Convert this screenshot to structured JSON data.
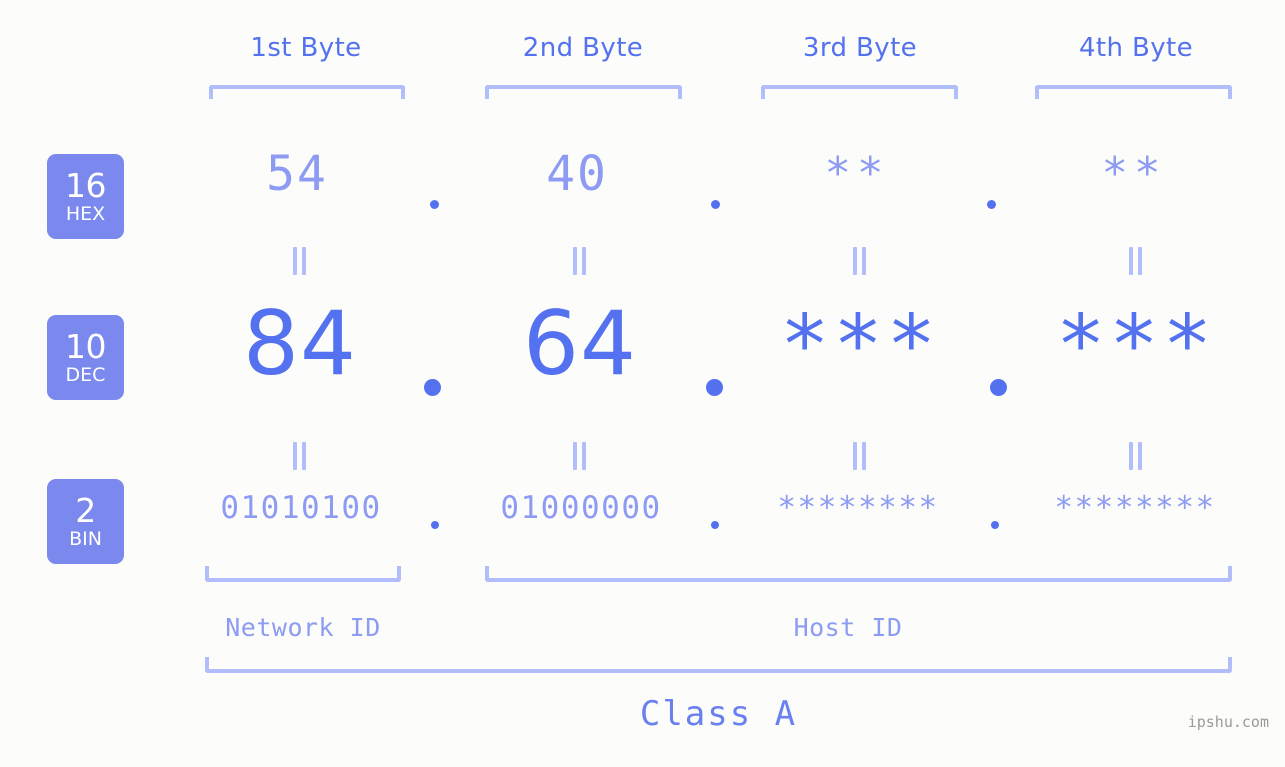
{
  "background_color": "#fcfdfa",
  "accent_colors": {
    "strong": "#5471ef",
    "medium": "#8d9bf2",
    "light": "#b2bdfb",
    "badge": "#7b88ed",
    "watermark": "#9a9a9a"
  },
  "byte_headers": [
    {
      "label": "1st Byte"
    },
    {
      "label": "2nd Byte"
    },
    {
      "label": "3rd Byte"
    },
    {
      "label": "4th Byte"
    }
  ],
  "bases": [
    {
      "number": "16",
      "name": "HEX"
    },
    {
      "number": "10",
      "name": "DEC"
    },
    {
      "number": "2",
      "name": "BIN"
    }
  ],
  "rows": {
    "hex": {
      "base_number": "16",
      "base_name": "HEX",
      "values": [
        "54",
        "40",
        "**",
        "**"
      ],
      "separators": [
        ".",
        ".",
        "."
      ]
    },
    "dec": {
      "base_number": "10",
      "base_name": "DEC",
      "values": [
        "84",
        "64",
        "***",
        "***"
      ],
      "separators": [
        ".",
        ".",
        "."
      ]
    },
    "bin": {
      "base_number": "2",
      "base_name": "BIN",
      "values": [
        "01010100",
        "01000000",
        "********",
        "********"
      ],
      "separators": [
        ".",
        ".",
        "."
      ]
    }
  },
  "equality_marks": {
    "glyph": "=",
    "rows": [
      "hex-to-dec",
      "dec-to-bin"
    ],
    "count_per_row": 4
  },
  "regions": [
    {
      "name": "network-id",
      "label": "Network ID"
    },
    {
      "name": "host-id",
      "label": "Host ID"
    }
  ],
  "class": {
    "label": "Class A"
  },
  "watermark": {
    "text": "ipshu.com"
  }
}
